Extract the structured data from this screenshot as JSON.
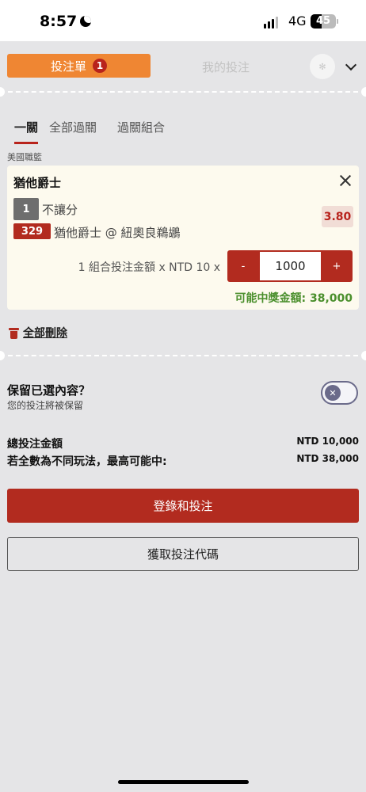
{
  "status_bar": {
    "time": "8:57",
    "network": "4G",
    "battery": "45",
    "battery_level": 0.45
  },
  "tabs": {
    "betslip_label": "投注單",
    "betslip_count": "1",
    "mybets_label": "我的投注"
  },
  "subtabs": [
    "一關",
    "全部過關",
    "過關組合"
  ],
  "league": "美國職籃",
  "bet": {
    "team": "猶他爵士",
    "selection_number": "1",
    "selection_type": "不讓分",
    "odds": "3.80",
    "game_number": "329",
    "match": "猶他爵士 @ 紐奧良鵜鶘",
    "stake_label": "1 組合投注金額 x NTD 10 x",
    "stake_minus": "-",
    "stake_plus": "+",
    "stake_value": "1000",
    "payout": "可能中獎金額: 38,000"
  },
  "delete_all": "全部刪除",
  "keep": {
    "title": "保留已選內容？",
    "subtitle": "您的投注將被保留"
  },
  "summary": {
    "total_label": "總投注金額",
    "total_value": "NTD 10,000",
    "max_label": "若全數為不同玩法，最高可能中:",
    "max_value": "NTD 38,000"
  },
  "buttons": {
    "login_bet": "登錄和投注",
    "get_code": "獲取投注代碼"
  },
  "icons": {
    "settings": "gear-icon",
    "collapse": "chevron-down-icon",
    "close": "close-icon",
    "trash": "trash-icon",
    "toggle": "x-icon"
  },
  "colors": {
    "accent": "#ef8633",
    "brand_red": "#b22b1f",
    "win_green": "#4a8f2c"
  }
}
